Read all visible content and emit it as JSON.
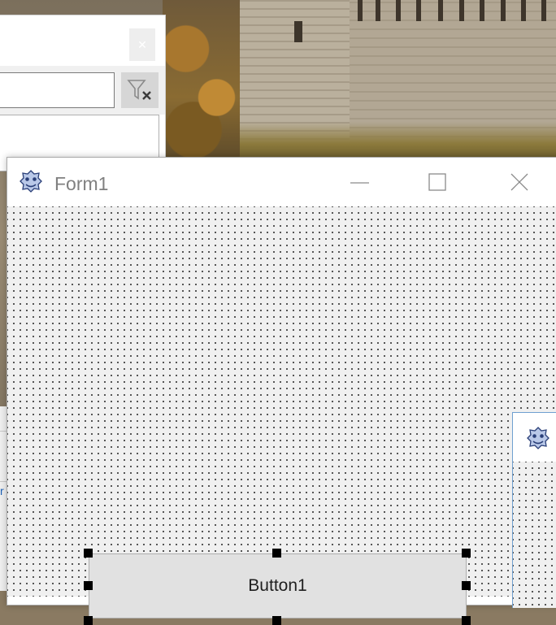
{
  "form": {
    "title": "Form1",
    "buttons": {
      "minimize": "minimize",
      "maximize": "maximize",
      "close": "close"
    },
    "button1_label": "Button1"
  },
  "bg_dialog": {
    "filter_value": "",
    "icons": {
      "close": "close-icon",
      "clear_filter": "filter-clear-icon"
    }
  },
  "colors": {
    "accent": "#6fa0d0",
    "button_face": "#e1e1e1",
    "title_text": "#808080"
  },
  "icons": {
    "app_icon": "lazarus-paw-icon"
  }
}
